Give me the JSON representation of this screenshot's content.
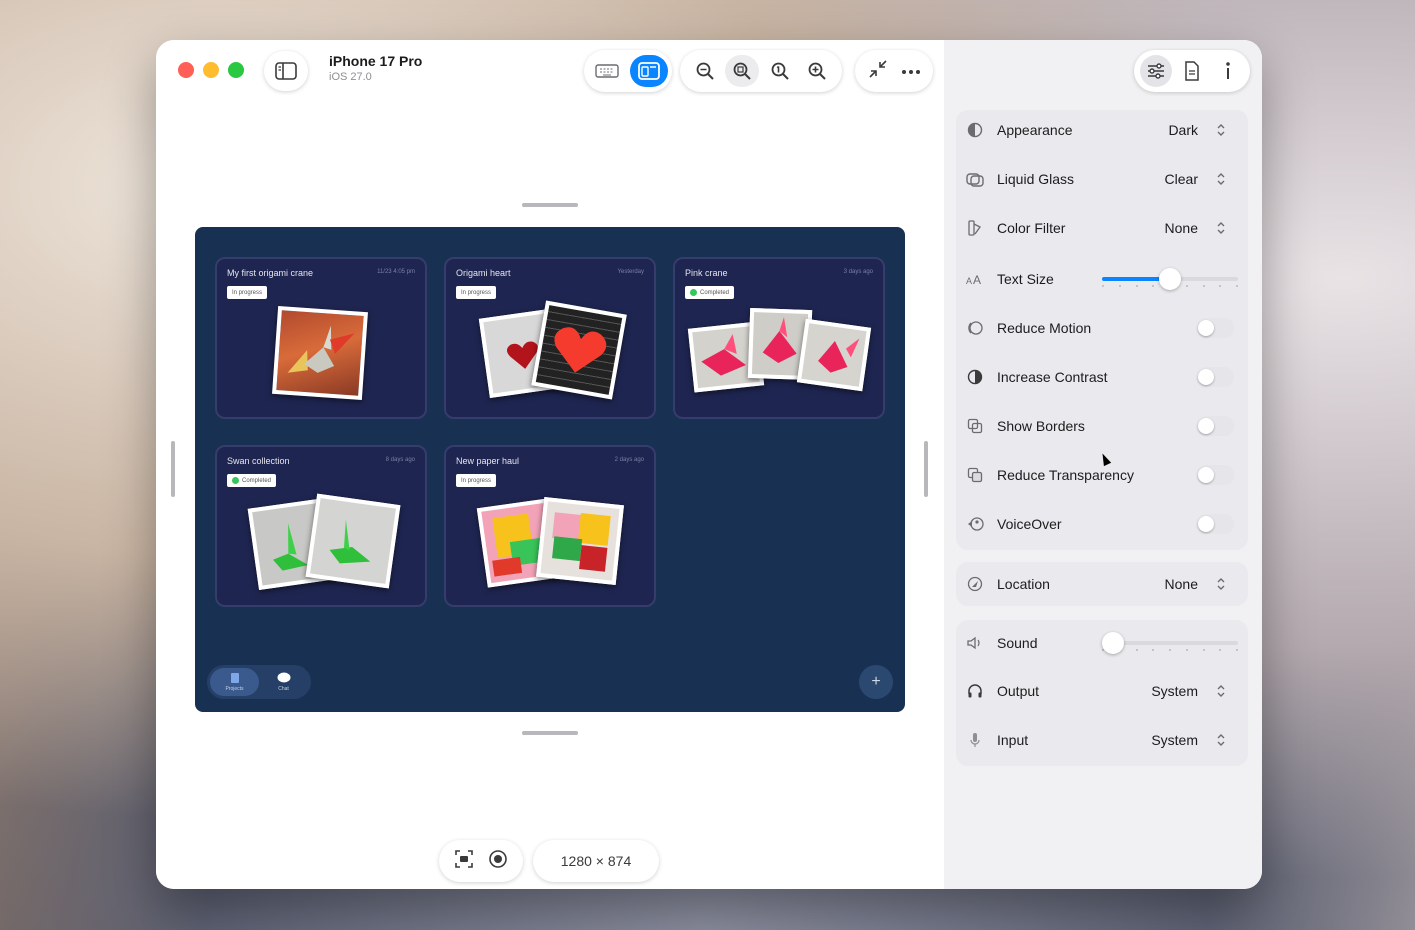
{
  "window": {
    "device_name": "iPhone 17 Pro",
    "os_version": "iOS 27.0",
    "resolution": "1280 × 874",
    "colors": {
      "close": "#ff5f57",
      "minimize": "#febc2e",
      "zoom": "#28c840",
      "accent": "#0a84ff"
    }
  },
  "toolbar": {
    "icons": [
      "sidebar-icon",
      "keyboard-icon",
      "window-layout-icon",
      "zoom-out-icon",
      "zoom-fit-icon",
      "zoom-actual-icon",
      "zoom-in-icon",
      "collapse-icon",
      "more-icon"
    ]
  },
  "simulator": {
    "cards": [
      {
        "title": "My first origami crane",
        "date": "11/23 4:05 pm",
        "badge": "In progress",
        "completed": false
      },
      {
        "title": "Origami heart",
        "date": "Yesterday",
        "badge": "In progress",
        "completed": false
      },
      {
        "title": "Pink crane",
        "date": "3 days ago",
        "badge": "Completed",
        "completed": true
      },
      {
        "title": "Swan collection",
        "date": "8 days ago",
        "badge": "Completed",
        "completed": true
      },
      {
        "title": "New paper haul",
        "date": "2 days ago",
        "badge": "In progress",
        "completed": false
      }
    ],
    "tabs": [
      "Projects",
      "Chat"
    ],
    "fab": "+"
  },
  "inspector": {
    "rows": {
      "appearance": {
        "label": "Appearance",
        "value": "Dark"
      },
      "liquid_glass": {
        "label": "Liquid Glass",
        "value": "Clear"
      },
      "color_filter": {
        "label": "Color Filter",
        "value": "None"
      },
      "text_size": {
        "label": "Text Size",
        "value_fraction": 0.5
      },
      "reduce_motion": {
        "label": "Reduce Motion",
        "on": false
      },
      "increase_contrast": {
        "label": "Increase Contrast",
        "on": false
      },
      "show_borders": {
        "label": "Show Borders",
        "on": false
      },
      "reduce_transparency": {
        "label": "Reduce Transparency",
        "on": false
      },
      "voiceover": {
        "label": "VoiceOver",
        "on": false
      },
      "location": {
        "label": "Location",
        "value": "None"
      },
      "sound": {
        "label": "Sound",
        "value_fraction": 0.0
      },
      "output": {
        "label": "Output",
        "value": "System"
      },
      "input": {
        "label": "Input",
        "value": "System"
      }
    }
  }
}
